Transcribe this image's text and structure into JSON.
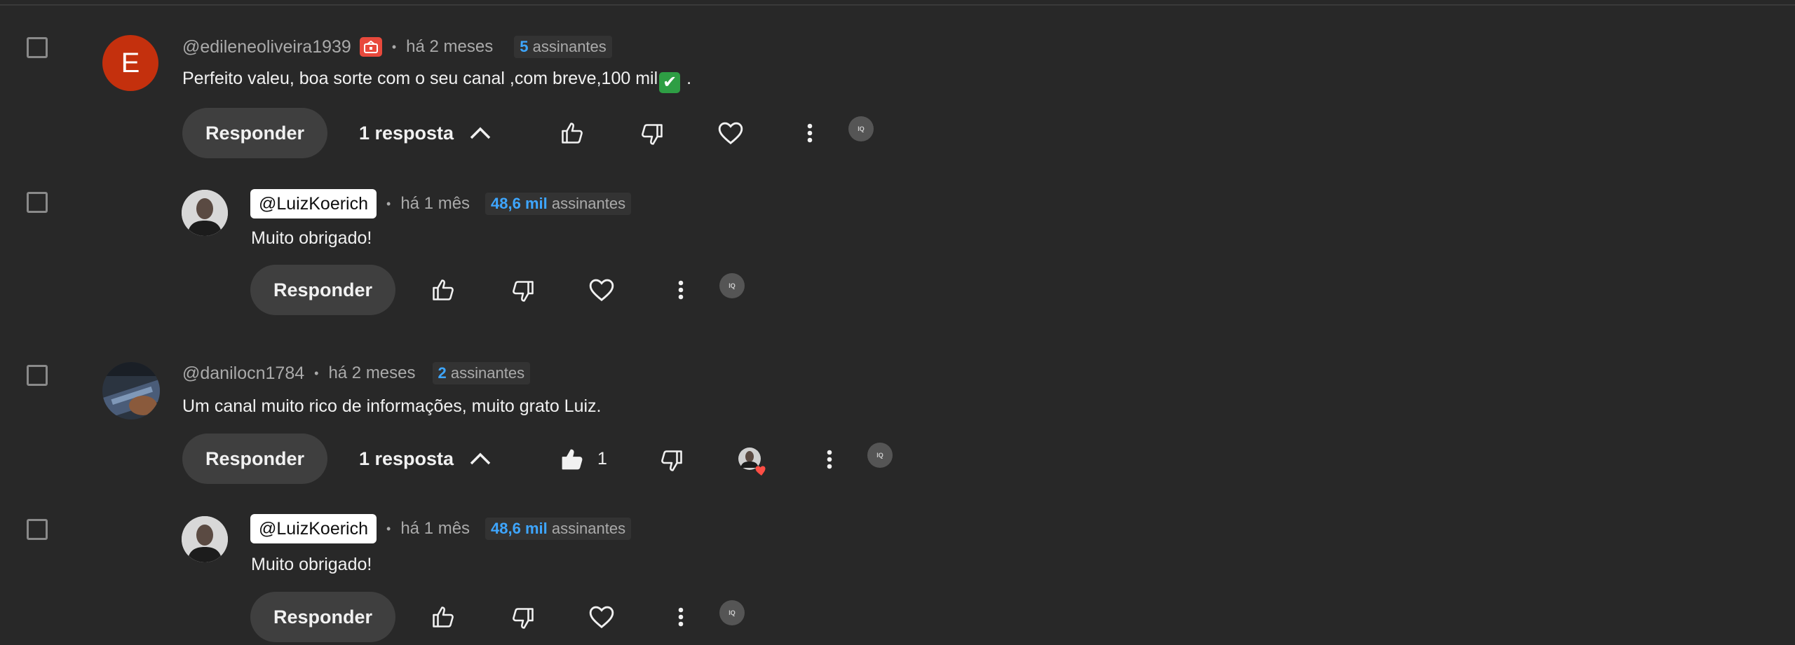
{
  "colors": {
    "background": "#282828",
    "accent_blue": "#3ea6ff",
    "avatar_letter_bg": "#c4300d",
    "heart_red": "#ff4e45"
  },
  "comments": [
    {
      "avatar_letter": "E",
      "handle": "@edileneoliveira1939",
      "member_badge_icon": "membership-gift-icon",
      "time": "há 2 meses",
      "subs_count": "5",
      "subs_label": "assinantes",
      "text_before_emoji": "Perfeito valeu, boa sorte com o seu canal ,com breve,100 mil",
      "emoji": "✔",
      "text_after_emoji": " .",
      "reply_label": "Responder",
      "replies_label": "1 resposta",
      "liked": false,
      "hearted": false
    },
    {
      "handle": "@LuizKoerich",
      "time": "há 1 mês",
      "subs_count": "48,6 mil",
      "subs_label": "assinantes",
      "text": "Muito obrigado!",
      "reply_label": "Responder"
    },
    {
      "handle": "@danilocn1784",
      "time": "há 2 meses",
      "subs_count": "2",
      "subs_label": "assinantes",
      "text": "Um canal muito rico de informações, muito grato Luiz.",
      "reply_label": "Responder",
      "replies_label": "1 resposta",
      "like_count": "1",
      "liked": true,
      "hearted": true
    },
    {
      "handle": "@LuizKoerich",
      "time": "há 1 mês",
      "subs_count": "48,6 mil",
      "subs_label": "assinantes",
      "text": "Muito obrigado!",
      "reply_label": "Responder"
    }
  ],
  "extension_icon_text": "IQ"
}
